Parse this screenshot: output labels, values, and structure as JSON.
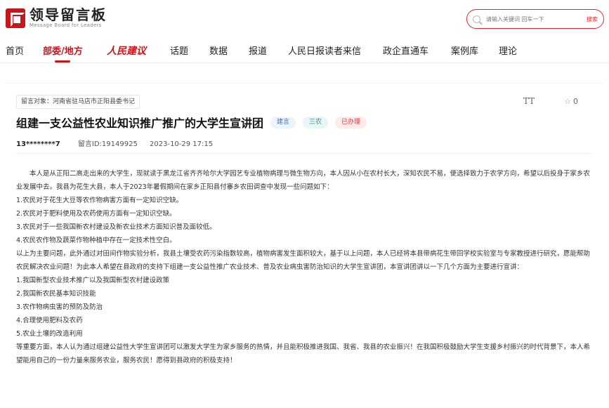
{
  "header": {
    "logo_cn": "领导留言板",
    "logo_en": "Message Board for Leaders",
    "search_placeholder": "请输入关键词 回车一下",
    "search_button": "搜索"
  },
  "nav": {
    "items": [
      "首页",
      "部委/地方",
      "人民建议",
      "话题",
      "数据",
      "报道",
      "人民日报读者来信",
      "政企直通车",
      "案例库",
      "理论"
    ],
    "active_index": 1
  },
  "message": {
    "target": "留言对象：河南省驻马店市正阳县委书记",
    "font_tool": "TT",
    "likes": "0",
    "title": "组建一支公益性农业知识推广推广的大学生宣讲团",
    "tags": [
      "建言",
      "三农",
      "已办理"
    ],
    "author": "13********7",
    "id_text": "留言ID:19149925",
    "datetime": "2023-10-29 17:15",
    "paragraphs": [
      "本人是从正阳二高走出来的大学生，现就读于黑龙江省齐齐哈尔大学园艺专业植物病理与微生物方向，本人因从小在农村长大，深知农民不易，便选择致力于农学方向，希望以后投身于家乡农业发展中去。我县为花生大县，本人于2023年暑假期间在家乡正阳县付寨乡农田调查中发现一些问题如下：",
      "1.农民对于花生大豆等农作物病害方面有一定知识空缺。",
      "2.农民对于肥料使用及农药使用方面有一定知识空缺。",
      "3.农民对于一些我国新农村建设及新农业技术方面知识普及面较低。",
      "4.农民农作物及蔬菜作物种植中存在一定技术性空白。",
      "以上为主要问题，此外通过对田间作物实验分析，我县土壤受农药污染指数较高，植物病害发生面积较大，基于以上问题，本人已经将本县带病花生带回学校实验室与专家教授进行研究，愿能帮助农民解决农业问题！为此本人希望在县政府的支持下组建一支公益性推广农业技术、普及农业病虫害防治知识的大学生宣讲团，本宣讲团讲以一下几个方面为主要进行宣讲：",
      "1.我国新型农业技术推广以及我国新型农村建设政策",
      "2.我国新农民基本知识技能",
      "3.农作物病虫害的预防及防治",
      "4.合理使用肥料及农药",
      "5.农业土壤的改造利用",
      "等重要方面，本人认为通过组建公益性大学生宣讲团可以激发大学生为家乡服务的热情，并且能积极推进我国、我省、我县的农业振兴！在我国积极鼓励大学生支援乡村振兴的时代背景下，本人希望能用自己的一份力量来服务农业，服务农民！愿得到县政府的积极支持！"
    ]
  }
}
